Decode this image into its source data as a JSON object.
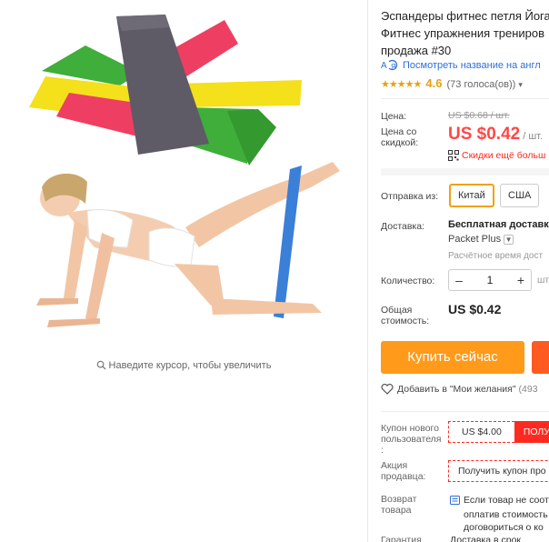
{
  "image": {
    "zoom_hint": "Наведите курсор, чтобы увеличить"
  },
  "product": {
    "title_lines": [
      "Эспандеры фитнес петля Йога",
      "Фитнес упражнения трениров",
      "продажа #30"
    ],
    "translate_link": "Посмотреть название на англ",
    "rating": {
      "stars": "★★★★★",
      "value": "4.6",
      "votes": "(73 голоса(ов))",
      "votes_dropdown": "▾"
    }
  },
  "price": {
    "price_label": "Цена:",
    "old_price": "US $0.68 / шт.",
    "discount_label_1": "Цена со",
    "discount_label_2": "скидкой:",
    "discount_amount": "US $0.42",
    "discount_unit": "/ шт.",
    "qr_text": "Скидки ещё больш"
  },
  "shipping": {
    "from_label": "Отправка из:",
    "options": [
      "Китай",
      "США"
    ],
    "selected": "Китай",
    "delivery_label": "Доставка:",
    "delivery_value": "Бесплатная доставка",
    "method": "Packet Plus",
    "time_text": "Расчётное время дост"
  },
  "quantity": {
    "label": "Количество:",
    "minus": "–",
    "value": "1",
    "plus": "+",
    "unit": "шт"
  },
  "total": {
    "label_1": "Общая",
    "label_2": "стоимость:",
    "value": "US $0.42"
  },
  "actions": {
    "buy_label": "Купить сейчас",
    "wishlist_label": "Добавить в \"Мои желания\"",
    "wishlist_count": "(493"
  },
  "coupons": {
    "new_user_label_1": "Купон нового",
    "new_user_label_2": "пользователя",
    "new_user_label_3": ":",
    "coupon_value": "US $4.00",
    "coupon_get": "ПОЛУ",
    "promo_label_1": "Акция",
    "promo_label_2": "продавца:",
    "promo_text": "Получить купон про"
  },
  "returns": {
    "label_1": "Возврат",
    "label_2": "товара",
    "text_1": "Если товар не соот",
    "text_2": "оплатив стоимость",
    "text_3": "договориться о ко"
  },
  "bottom": {
    "label": "Гарантия",
    "text": "Доставка в срок"
  },
  "colors": {
    "accent_orange": "#ff9a1a",
    "price_red": "#ff4747",
    "link_blue": "#2e6fd9",
    "star_gold": "#e6a216",
    "band_purple": "#5e5a66",
    "band_green": "#3fae3a",
    "band_yellow": "#f4e01b",
    "band_pink": "#ee3f63",
    "band_blue": "#3a7fd8"
  }
}
